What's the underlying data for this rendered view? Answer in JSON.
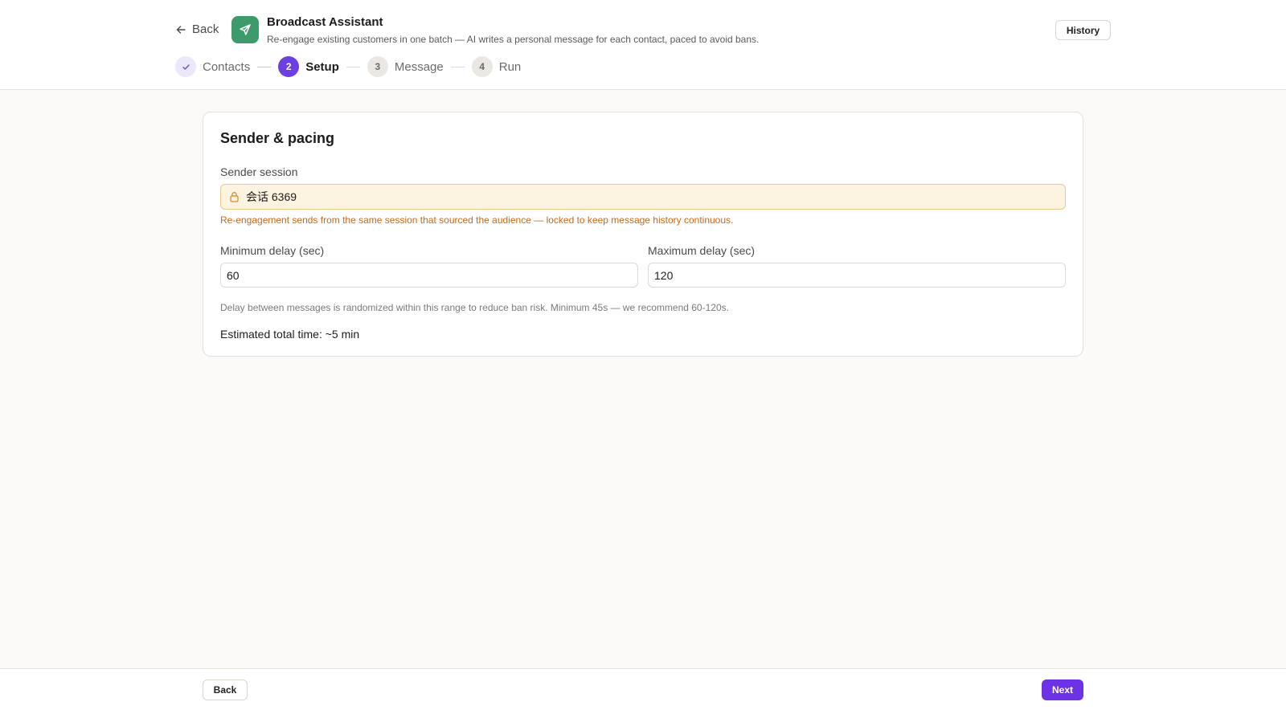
{
  "header": {
    "back_label": "Back",
    "app_icon": "send-icon",
    "title": "Broadcast Assistant",
    "subtitle": "Re-engage existing customers in one batch — AI writes a personal message for each contact, paced to avoid bans.",
    "history_label": "History",
    "brand_color": "#3d9a6b"
  },
  "stepper": {
    "steps": [
      {
        "number": "✓",
        "label": "Contacts",
        "state": "done"
      },
      {
        "number": "2",
        "label": "Setup",
        "state": "active"
      },
      {
        "number": "3",
        "label": "Message",
        "state": "todo"
      },
      {
        "number": "4",
        "label": "Run",
        "state": "todo"
      }
    ],
    "accent_color": "#6d3fe0"
  },
  "card": {
    "title": "Sender & pacing",
    "sender": {
      "label": "Sender session",
      "value": "会话 6369",
      "icon": "lock-icon",
      "warning": "Re-engagement sends from the same session that sourced the audience — locked to keep message history continuous.",
      "warning_color": "#c76a16"
    },
    "min_delay": {
      "label": "Minimum delay (sec)",
      "value": "60"
    },
    "max_delay": {
      "label": "Maximum delay (sec)",
      "value": "120"
    },
    "hint": "Delay between messages is randomized within this range to reduce ban risk. Minimum 45s — we recommend 60-120s.",
    "estimate": "Estimated total time: ~5 min"
  },
  "footer": {
    "back_label": "Back",
    "next_label": "Next",
    "next_color": "#6d32e6"
  }
}
